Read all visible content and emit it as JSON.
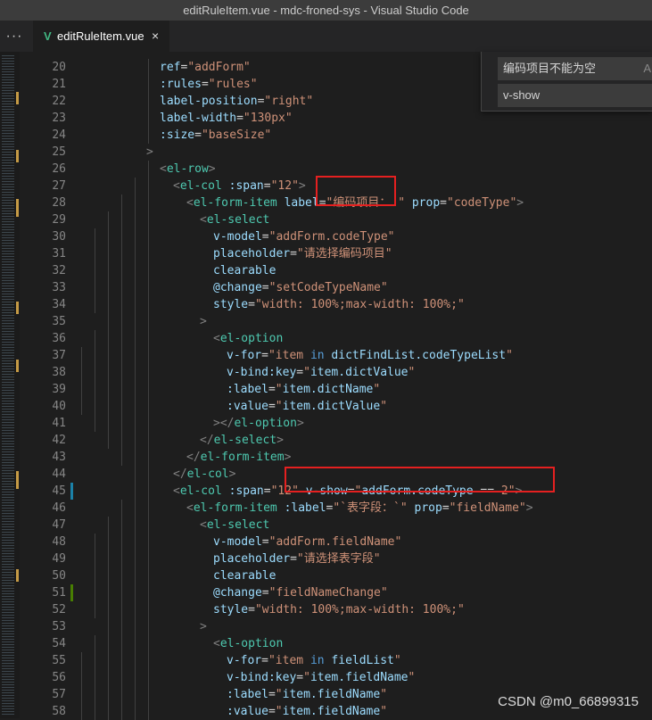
{
  "window": {
    "title": "editRuleItem.vue - mdc-froned-sys - Visual Studio Code"
  },
  "tabs": [
    {
      "label": "editRuleItem.vue",
      "icon": "vue-icon",
      "close": "×",
      "modified": false
    }
  ],
  "more_label": "···",
  "find_widget": {
    "search_value": "编码项目不能为空",
    "replace_value": "v-show",
    "hint": "A"
  },
  "watermark": "CSDN @m0_66899315",
  "colors": {
    "tag": "#4ec9b0",
    "attr": "#9cdcfe",
    "string": "#ce9178",
    "keyword": "#569cd6",
    "punct": "#808080",
    "highlight_box": "#e52020"
  },
  "code_lines": [
    {
      "n": "20",
      "indent": 3,
      "mark": "",
      "tokens": [
        [
          "attr",
          "ref"
        ],
        [
          "eq",
          "="
        ],
        [
          "str",
          "\"addForm\""
        ]
      ]
    },
    {
      "n": "21",
      "indent": 3,
      "mark": "",
      "tokens": [
        [
          "attr",
          ":rules"
        ],
        [
          "eq",
          "="
        ],
        [
          "str",
          "\"rules\""
        ]
      ]
    },
    {
      "n": "22",
      "indent": 3,
      "mark": "",
      "tokens": [
        [
          "attr",
          "label-position"
        ],
        [
          "eq",
          "="
        ],
        [
          "str",
          "\"right\""
        ]
      ]
    },
    {
      "n": "23",
      "indent": 3,
      "mark": "",
      "tokens": [
        [
          "attr",
          "label-width"
        ],
        [
          "eq",
          "="
        ],
        [
          "str",
          "\"130px\""
        ]
      ]
    },
    {
      "n": "24",
      "indent": 3,
      "mark": "",
      "tokens": [
        [
          "attr",
          ":size"
        ],
        [
          "eq",
          "="
        ],
        [
          "str",
          "\"baseSize\""
        ]
      ]
    },
    {
      "n": "25",
      "indent": 2,
      "mark": "",
      "tokens": [
        [
          "punc",
          ">"
        ]
      ]
    },
    {
      "n": "26",
      "indent": 3,
      "mark": "",
      "tokens": [
        [
          "punc",
          "<"
        ],
        [
          "tag",
          "el-row"
        ],
        [
          "punc",
          ">"
        ]
      ]
    },
    {
      "n": "27",
      "indent": 4,
      "mark": "",
      "tokens": [
        [
          "punc",
          "<"
        ],
        [
          "tag",
          "el-col"
        ],
        [
          "eq",
          " "
        ],
        [
          "attr",
          ":span"
        ],
        [
          "eq",
          "="
        ],
        [
          "str",
          "\"12\""
        ],
        [
          "punc",
          ">"
        ]
      ]
    },
    {
      "n": "28",
      "indent": 5,
      "mark": "",
      "tokens": [
        [
          "punc",
          "<"
        ],
        [
          "tag",
          "el-form-item"
        ],
        [
          "eq",
          " "
        ],
        [
          "attr",
          "label"
        ],
        [
          "eq",
          "="
        ],
        [
          "str",
          "\"编码项目："
        ],
        [
          "eq",
          " "
        ],
        [
          "str",
          "\""
        ],
        [
          "eq",
          " "
        ],
        [
          "attr",
          "prop"
        ],
        [
          "eq",
          "="
        ],
        [
          "str",
          "\"codeType\""
        ],
        [
          "punc",
          ">"
        ]
      ]
    },
    {
      "n": "29",
      "indent": 6,
      "mark": "",
      "tokens": [
        [
          "punc",
          "<"
        ],
        [
          "tag",
          "el-select"
        ]
      ]
    },
    {
      "n": "30",
      "indent": 7,
      "mark": "",
      "tokens": [
        [
          "attr",
          "v-model"
        ],
        [
          "eq",
          "="
        ],
        [
          "str",
          "\"addForm.codeType\""
        ]
      ]
    },
    {
      "n": "31",
      "indent": 7,
      "mark": "",
      "tokens": [
        [
          "attr",
          "placeholder"
        ],
        [
          "eq",
          "="
        ],
        [
          "str",
          "\"请选择编码项目\""
        ]
      ]
    },
    {
      "n": "32",
      "indent": 7,
      "mark": "",
      "tokens": [
        [
          "attr",
          "clearable"
        ]
      ]
    },
    {
      "n": "33",
      "indent": 7,
      "mark": "",
      "tokens": [
        [
          "attr",
          "@change"
        ],
        [
          "eq",
          "="
        ],
        [
          "str",
          "\"setCodeTypeName\""
        ]
      ]
    },
    {
      "n": "34",
      "indent": 7,
      "mark": "",
      "tokens": [
        [
          "attr",
          "style"
        ],
        [
          "eq",
          "="
        ],
        [
          "str",
          "\"width: 100%;max-width: 100%;\""
        ]
      ]
    },
    {
      "n": "35",
      "indent": 6,
      "mark": "",
      "tokens": [
        [
          "punc",
          ">"
        ]
      ]
    },
    {
      "n": "36",
      "indent": 7,
      "mark": "",
      "tokens": [
        [
          "punc",
          "<"
        ],
        [
          "tag",
          "el-option"
        ]
      ]
    },
    {
      "n": "37",
      "indent": 8,
      "mark": "",
      "tokens": [
        [
          "attr",
          "v-for"
        ],
        [
          "eq",
          "="
        ],
        [
          "str",
          "\"item "
        ],
        [
          "kw",
          "in"
        ],
        [
          "attr",
          " dictFindList.codeTypeList"
        ],
        [
          "str",
          "\""
        ]
      ]
    },
    {
      "n": "38",
      "indent": 8,
      "mark": "",
      "tokens": [
        [
          "attr",
          "v-bind:key"
        ],
        [
          "eq",
          "="
        ],
        [
          "str",
          "\""
        ],
        [
          "attr",
          "item.dictValue"
        ],
        [
          "str",
          "\""
        ]
      ]
    },
    {
      "n": "39",
      "indent": 8,
      "mark": "",
      "tokens": [
        [
          "attr",
          ":label"
        ],
        [
          "eq",
          "="
        ],
        [
          "str",
          "\""
        ],
        [
          "attr",
          "item.dictName"
        ],
        [
          "str",
          "\""
        ]
      ]
    },
    {
      "n": "40",
      "indent": 8,
      "mark": "",
      "tokens": [
        [
          "attr",
          ":value"
        ],
        [
          "eq",
          "="
        ],
        [
          "str",
          "\""
        ],
        [
          "attr",
          "item.dictValue"
        ],
        [
          "str",
          "\""
        ]
      ]
    },
    {
      "n": "41",
      "indent": 7,
      "mark": "",
      "tokens": [
        [
          "punc",
          "></"
        ],
        [
          "tag",
          "el-option"
        ],
        [
          "punc",
          ">"
        ]
      ]
    },
    {
      "n": "42",
      "indent": 6,
      "mark": "",
      "tokens": [
        [
          "punc",
          "</"
        ],
        [
          "tag",
          "el-select"
        ],
        [
          "punc",
          ">"
        ]
      ]
    },
    {
      "n": "43",
      "indent": 5,
      "mark": "",
      "tokens": [
        [
          "punc",
          "</"
        ],
        [
          "tag",
          "el-form-item"
        ],
        [
          "punc",
          ">"
        ]
      ]
    },
    {
      "n": "44",
      "indent": 4,
      "mark": "",
      "tokens": [
        [
          "punc",
          "</"
        ],
        [
          "tag",
          "el-col"
        ],
        [
          "punc",
          ">"
        ]
      ]
    },
    {
      "n": "45",
      "indent": 4,
      "mark": "mod",
      "tokens": [
        [
          "punc",
          "<"
        ],
        [
          "tag",
          "el-col"
        ],
        [
          "eq",
          " "
        ],
        [
          "attr",
          ":span"
        ],
        [
          "eq",
          "="
        ],
        [
          "str",
          "\"12\""
        ],
        [
          "eq",
          " "
        ],
        [
          "attr",
          "v-show"
        ],
        [
          "eq",
          "="
        ],
        [
          "str",
          "\""
        ],
        [
          "attr",
          "addForm.codeType"
        ],
        [
          "eq",
          " == "
        ],
        [
          "str",
          "2\""
        ],
        [
          "punc",
          ">"
        ]
      ]
    },
    {
      "n": "46",
      "indent": 5,
      "mark": "",
      "tokens": [
        [
          "punc",
          "<"
        ],
        [
          "tag",
          "el-form-item"
        ],
        [
          "eq",
          " "
        ],
        [
          "attr",
          ":label"
        ],
        [
          "eq",
          "="
        ],
        [
          "str",
          "\"`表字段：`\""
        ],
        [
          "eq",
          " "
        ],
        [
          "attr",
          "prop"
        ],
        [
          "eq",
          "="
        ],
        [
          "str",
          "\"fieldName\""
        ],
        [
          "punc",
          ">"
        ]
      ]
    },
    {
      "n": "47",
      "indent": 6,
      "mark": "",
      "tokens": [
        [
          "punc",
          "<"
        ],
        [
          "tag",
          "el-select"
        ]
      ]
    },
    {
      "n": "48",
      "indent": 7,
      "mark": "",
      "tokens": [
        [
          "attr",
          "v-model"
        ],
        [
          "eq",
          "="
        ],
        [
          "str",
          "\"addForm.fieldName\""
        ]
      ]
    },
    {
      "n": "49",
      "indent": 7,
      "mark": "",
      "tokens": [
        [
          "attr",
          "placeholder"
        ],
        [
          "eq",
          "="
        ],
        [
          "str",
          "\"请选择表字段\""
        ]
      ]
    },
    {
      "n": "50",
      "indent": 7,
      "mark": "",
      "tokens": [
        [
          "attr",
          "clearable"
        ]
      ]
    },
    {
      "n": "51",
      "indent": 7,
      "mark": "add",
      "tokens": [
        [
          "attr",
          "@change"
        ],
        [
          "eq",
          "="
        ],
        [
          "str",
          "\"fieldNameChange\""
        ]
      ]
    },
    {
      "n": "52",
      "indent": 7,
      "mark": "",
      "tokens": [
        [
          "attr",
          "style"
        ],
        [
          "eq",
          "="
        ],
        [
          "str",
          "\"width: 100%;max-width: 100%;\""
        ]
      ]
    },
    {
      "n": "53",
      "indent": 6,
      "mark": "",
      "tokens": [
        [
          "punc",
          ">"
        ]
      ]
    },
    {
      "n": "54",
      "indent": 7,
      "mark": "",
      "tokens": [
        [
          "punc",
          "<"
        ],
        [
          "tag",
          "el-option"
        ]
      ]
    },
    {
      "n": "55",
      "indent": 8,
      "mark": "",
      "tokens": [
        [
          "attr",
          "v-for"
        ],
        [
          "eq",
          "="
        ],
        [
          "str",
          "\"item "
        ],
        [
          "kw",
          "in"
        ],
        [
          "attr",
          " fieldList"
        ],
        [
          "str",
          "\""
        ]
      ]
    },
    {
      "n": "56",
      "indent": 8,
      "mark": "",
      "tokens": [
        [
          "attr",
          "v-bind:key"
        ],
        [
          "eq",
          "="
        ],
        [
          "str",
          "\""
        ],
        [
          "attr",
          "item.fieldName"
        ],
        [
          "str",
          "\""
        ]
      ]
    },
    {
      "n": "57",
      "indent": 8,
      "mark": "",
      "tokens": [
        [
          "attr",
          ":label"
        ],
        [
          "eq",
          "="
        ],
        [
          "str",
          "\""
        ],
        [
          "attr",
          "item.fieldName"
        ],
        [
          "str",
          "\""
        ]
      ]
    },
    {
      "n": "58",
      "indent": 8,
      "mark": "",
      "tokens": [
        [
          "attr",
          ":value"
        ],
        [
          "eq",
          "="
        ],
        [
          "str",
          "\""
        ],
        [
          "attr",
          "item.fieldName"
        ],
        [
          "str",
          "\""
        ]
      ]
    }
  ]
}
